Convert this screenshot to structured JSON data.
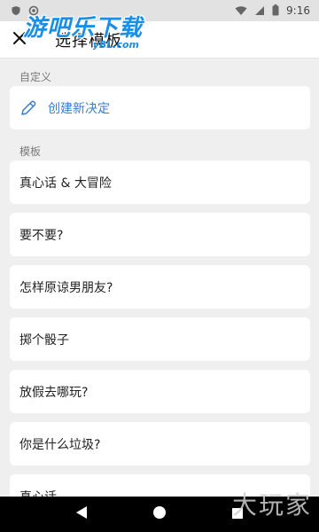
{
  "status_bar": {
    "time": "9:16",
    "icons": [
      "shield-icon",
      "circle-icon",
      "wifi-icon",
      "signal-icon",
      "battery-icon"
    ]
  },
  "app_bar": {
    "title": "选择模板",
    "back_icon": "close-x-icon"
  },
  "watermark": {
    "logo_main": "游吧乐下载",
    "logo_sub": "yBL.com",
    "corner": "大玩家"
  },
  "sections": [
    {
      "label": "自定义",
      "items": [
        {
          "label": "创建新决定",
          "icon": "pencil-icon"
        }
      ]
    },
    {
      "label": "模板",
      "items": [
        {
          "label": "真心话 & 大冒险"
        },
        {
          "label": "要不要?"
        },
        {
          "label": "怎样原谅男朋友?"
        },
        {
          "label": "掷个骰子"
        },
        {
          "label": "放假去哪玩?"
        },
        {
          "label": "你是什么垃圾?"
        },
        {
          "label": "真心话"
        }
      ]
    }
  ],
  "nav_bar": {
    "icons": [
      "back-triangle-icon",
      "home-circle-icon",
      "recents-square-icon"
    ]
  },
  "colors": {
    "accent": "#3a7bd5",
    "background": "#efefef",
    "card": "#ffffff"
  }
}
